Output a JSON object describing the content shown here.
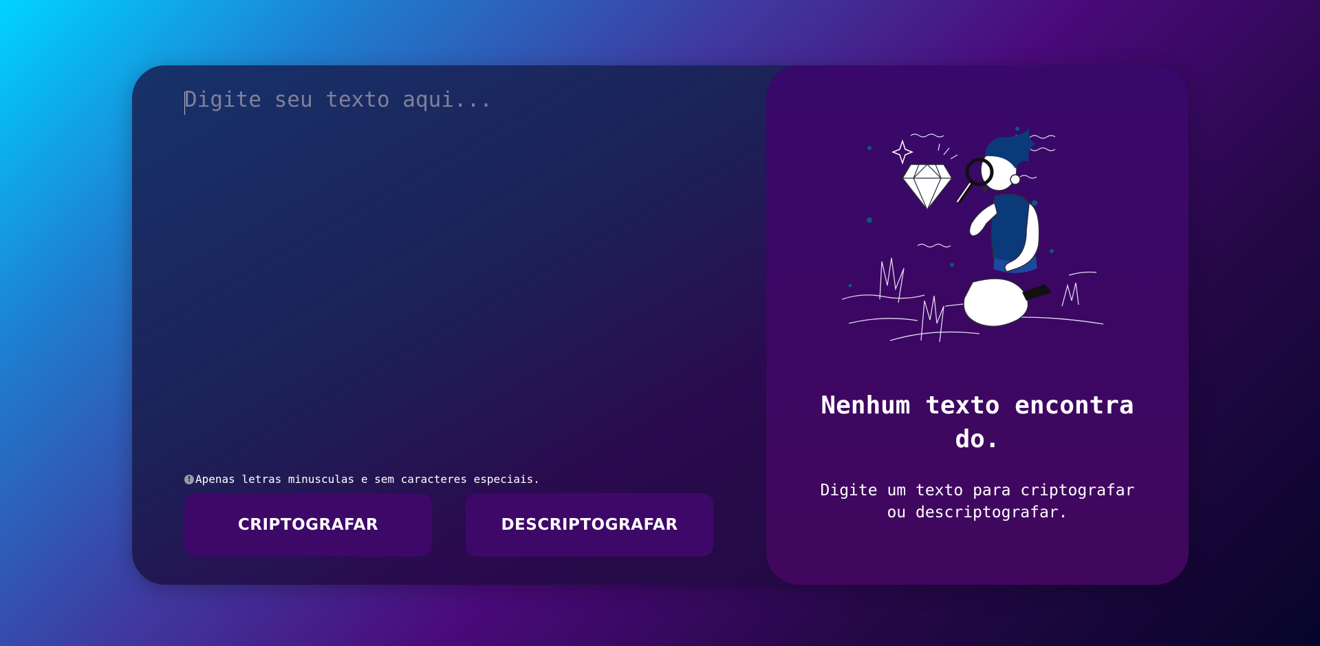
{
  "input": {
    "value": "",
    "placeholder": "Digite seu texto aqui..."
  },
  "hint": {
    "icon": "info-icon",
    "text": "Apenas letras minusculas e sem caracteres especiais."
  },
  "buttons": {
    "encrypt_label": "CRIPTOGRAFAR",
    "decrypt_label": "DESCRIPTOGRAFAR"
  },
  "output": {
    "illustration": "person-magnifier-diamond-illustration",
    "title": "Nenhum texto encontrado.",
    "description": "Digite um texto para criptografar ou descriptografar."
  },
  "colors": {
    "button_bg": "#3e0868",
    "panel_bg": "#3c0762",
    "accent_blue": "#0a3a7a"
  }
}
